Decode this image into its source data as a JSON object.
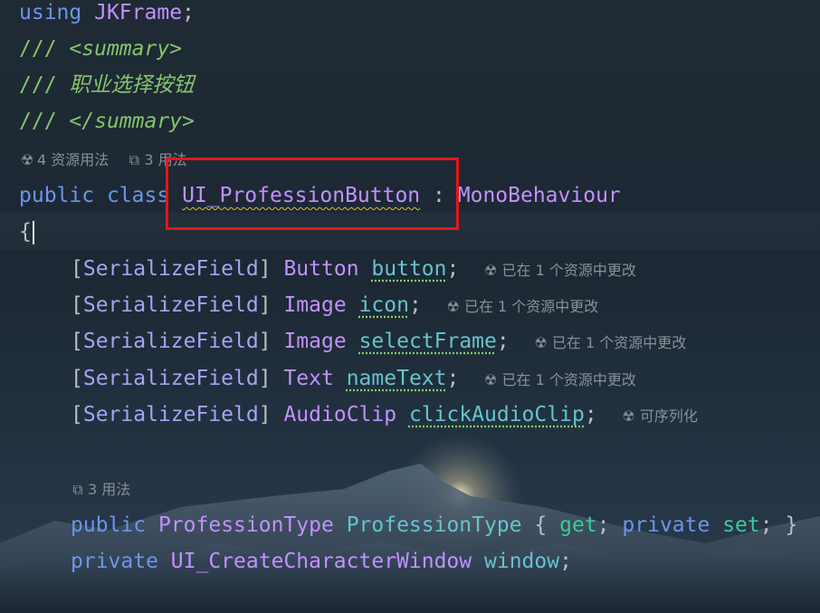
{
  "editor": {
    "using_kw": "using",
    "using_ns": "JKFrame",
    "semi": ";",
    "doc_slashes": "///",
    "doc_open_tag": "<summary>",
    "doc_text": "职业选择按钮",
    "doc_close_tag": "</summary>",
    "lens_asset_usages": "4 资源用法",
    "lens_usages_1": "3 用法",
    "kw_public": "public",
    "kw_class": "class",
    "class_name": "UI_ProfessionButton",
    "colon": ":",
    "base_class": "MonoBehaviour",
    "open_brace": "{",
    "fields": [
      {
        "attr_open": "[",
        "attr": "SerializeField",
        "attr_close": "]",
        "type": "Button",
        "name": "button",
        "hint": "已在 1 个资源中更改"
      },
      {
        "attr_open": "[",
        "attr": "SerializeField",
        "attr_close": "]",
        "type": "Image",
        "name": "icon",
        "hint": "已在 1 个资源中更改"
      },
      {
        "attr_open": "[",
        "attr": "SerializeField",
        "attr_close": "]",
        "type": "Image",
        "name": "selectFrame",
        "hint": "已在 1 个资源中更改"
      },
      {
        "attr_open": "[",
        "attr": "SerializeField",
        "attr_close": "]",
        "type": "Text",
        "name": "nameText",
        "hint": "已在 1 个资源中更改"
      },
      {
        "attr_open": "[",
        "attr": "SerializeField",
        "attr_close": "]",
        "type": "AudioClip",
        "name": "clickAudioClip",
        "hint": "可序列化"
      }
    ],
    "lens_usages_2": "3 用法",
    "prop_type": "ProfessionType",
    "prop_name": "ProfessionType",
    "brace_open": "{",
    "kw_get": "get",
    "kw_private": "private",
    "kw_set": "set",
    "brace_close": "}",
    "window_type": "UI_CreateCharacterWindow",
    "window_name": "window"
  },
  "colors": {
    "keyword": "#6c95eb",
    "type": "#c191ff",
    "comment": "#85c46c",
    "highlight_box": "#e3161b"
  },
  "icons": {
    "asset_usage": "unity-icon",
    "usages": "external-link-icon"
  }
}
